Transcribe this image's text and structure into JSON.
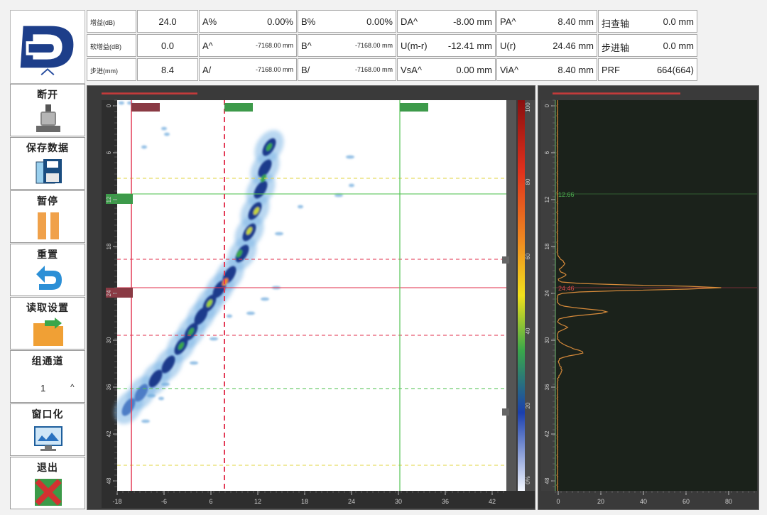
{
  "params": {
    "row1": [
      {
        "key": "增益(dB)",
        "value": "24.0"
      },
      {
        "key": "A%",
        "value": "0.00%"
      },
      {
        "key": "B%",
        "value": "0.00%"
      },
      {
        "key": "DA^",
        "value": "-8.00 mm"
      },
      {
        "key": "PA^",
        "value": "8.40 mm"
      },
      {
        "key": "扫查轴",
        "value": "0.0 mm"
      }
    ],
    "row2": [
      {
        "key": "软增益(dB)",
        "value": "0.0"
      },
      {
        "key": "A^",
        "value": "-7168.00 mm"
      },
      {
        "key": "B^",
        "value": "-7168.00 mm"
      },
      {
        "key": "U(m-r)",
        "value": "-12.41 mm"
      },
      {
        "key": "U(r)",
        "value": "24.46 mm"
      },
      {
        "key": "步进轴",
        "value": "0.0 mm"
      }
    ],
    "row3": [
      {
        "key": "步进(mm)",
        "value": "8.4"
      },
      {
        "key": "A/",
        "value": "-7168.00 mm"
      },
      {
        "key": "B/",
        "value": "-7168.00 mm"
      },
      {
        "key": "VsA^",
        "value": "0.00 mm"
      },
      {
        "key": "ViA^",
        "value": "8.40 mm"
      },
      {
        "key": "PRF",
        "value": "664(664)"
      }
    ]
  },
  "sidebar": {
    "disconnect": "断开",
    "save": "保存数据",
    "pause": "暂停",
    "reset": "重置",
    "load": "读取设置",
    "channel": "组通道",
    "channel_value": "1",
    "window": "窗口化",
    "exit": "退出"
  },
  "bscan": {
    "y_ticks": [
      "0",
      "6",
      "12",
      "18",
      "24",
      "30",
      "36",
      "42",
      "48"
    ],
    "x_ticks": [
      "-18",
      "-6",
      "6",
      "12",
      "18",
      "24",
      "30",
      "36",
      "42"
    ],
    "color_ticks": [
      "100",
      "80",
      "60",
      "40",
      "20",
      "0%"
    ]
  },
  "ascan": {
    "y_ticks": [
      "0",
      "6",
      "12",
      "18",
      "24",
      "30",
      "36",
      "42",
      "48"
    ],
    "x_ticks": [
      "0",
      "20",
      "40",
      "60",
      "80"
    ],
    "marker_green": "12.66",
    "marker_red": "24.46"
  },
  "colors": {
    "accent_blue": "#1d3e8a",
    "panel_bg": "#3a3a3a",
    "ascan_bg": "#1b221b",
    "grid_green": "#56c456",
    "grid_red": "#e33b56",
    "grid_yellow": "#e2d64a"
  }
}
